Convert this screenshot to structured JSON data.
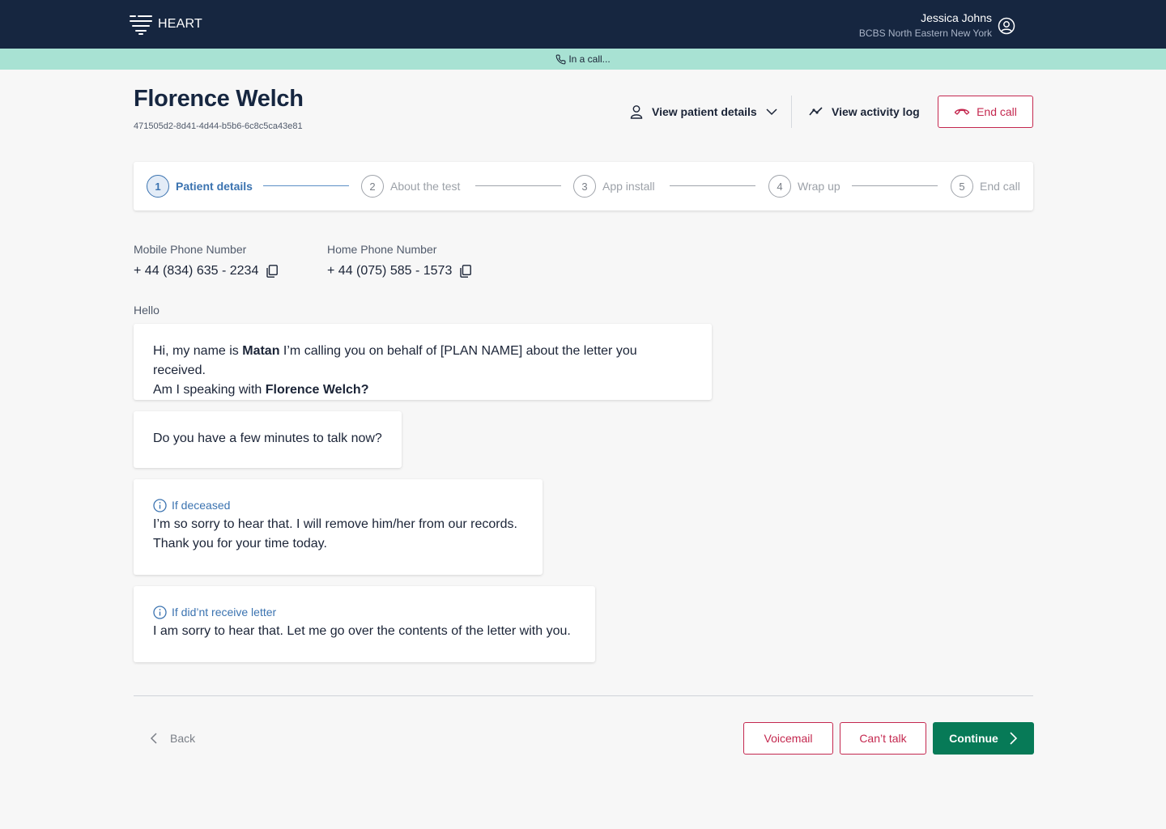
{
  "brand": {
    "name": "HEART"
  },
  "user": {
    "name": "Jessica Johns",
    "org": "BCBS North Eastern New York"
  },
  "call_status": "In a call...",
  "patient": {
    "name": "Florence Welch",
    "id": "471505d2-8d41-4d44-b5b6-6c8c5ca43e81"
  },
  "actions": {
    "view_details": "View patient details",
    "view_log": "View activity log",
    "end_call": "End call"
  },
  "steps": [
    {
      "num": "1",
      "label": "Patient details",
      "active": true
    },
    {
      "num": "2",
      "label": "About the test",
      "active": false
    },
    {
      "num": "3",
      "label": "App install",
      "active": false
    },
    {
      "num": "4",
      "label": "Wrap up",
      "active": false
    },
    {
      "num": "5",
      "label": "End call",
      "active": false
    }
  ],
  "phones": {
    "mobile": {
      "label": "Mobile Phone Number",
      "value": "+ 44 (834) 635 - 2234"
    },
    "home": {
      "label": "Home Phone Number",
      "value": "+ 44 (075) 585 - 1573"
    }
  },
  "script": {
    "section": "Hello",
    "intro": {
      "t1": "Hi, my name is ",
      "agent": "Matan",
      "t2": " I’m calling you on behalf of [PLAN NAME] about the letter you received.",
      "t3": "Am I speaking with ",
      "patient": "Florence Welch?"
    },
    "ask_time": "Do you have a few minutes to talk now?",
    "deceased": {
      "tag": "If deceased",
      "line1": "I’m so sorry to hear that. I will remove him/her from our records.",
      "line2": "Thank you for your time today."
    },
    "no_letter": {
      "tag": "If did’nt receive letter",
      "text": "I am sorry to hear that. Let me go over the contents of the letter with you."
    }
  },
  "footer": {
    "back": "Back",
    "voicemail": "Voicemail",
    "cant_talk": "Can’t talk",
    "continue": "Continue"
  },
  "colors": {
    "navy": "#162640",
    "call_banner": "#a8e2d3",
    "accent_red": "#c4284f",
    "primary_green": "#077a57",
    "step_blue": "#3b73b0"
  }
}
